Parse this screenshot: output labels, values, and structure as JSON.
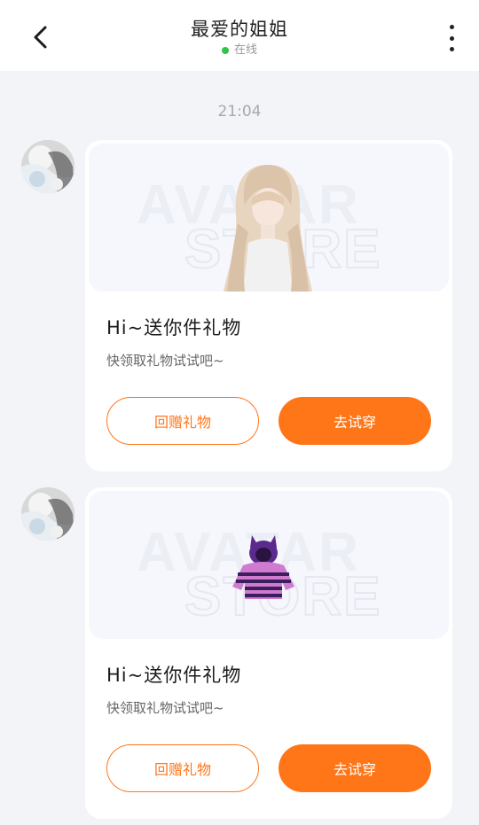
{
  "header": {
    "title": "最爱的姐姐",
    "status": "在线",
    "status_color": "#2fc545",
    "back_icon": "chevron-left-icon",
    "more_icon": "more-vertical-icon"
  },
  "chat": {
    "timestamp": "21:04",
    "messages": [
      {
        "title": "Hi~送你件礼物",
        "subtitle": "快领取礼物试试吧~",
        "gift_item": "long-blonde-wig",
        "watermark_line1": "AVATAR",
        "watermark_line2": "STORE",
        "return_gift_label": "回赠礼物",
        "try_on_label": "去试穿"
      },
      {
        "title": "Hi~送你件礼物",
        "subtitle": "快领取礼物试试吧~",
        "gift_item": "purple-cat-ear-striped-hoodie",
        "watermark_line1": "AVATAR",
        "watermark_line2": "STORE",
        "return_gift_label": "回赠礼物",
        "try_on_label": "去试穿"
      }
    ]
  },
  "colors": {
    "accent": "#ff7619",
    "background": "#f3f4f7"
  }
}
